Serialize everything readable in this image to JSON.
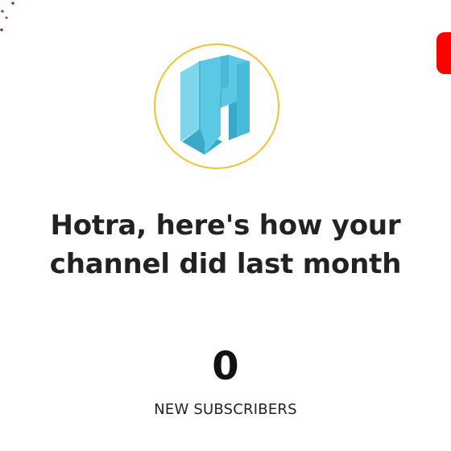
{
  "report": {
    "headline_line1": "Hotra, here's how your",
    "headline_line2": "channel did last month",
    "metric_value": "0",
    "metric_label": "NEW SUBSCRIBERS"
  },
  "avatar": {
    "icon": "channel-logo-icon",
    "ring_color": "#f2c230",
    "logo_color": "#5bc8e4"
  },
  "decor": {
    "confetti_color": "#7b2a8f",
    "corner_badge_color": "#ff0000"
  }
}
